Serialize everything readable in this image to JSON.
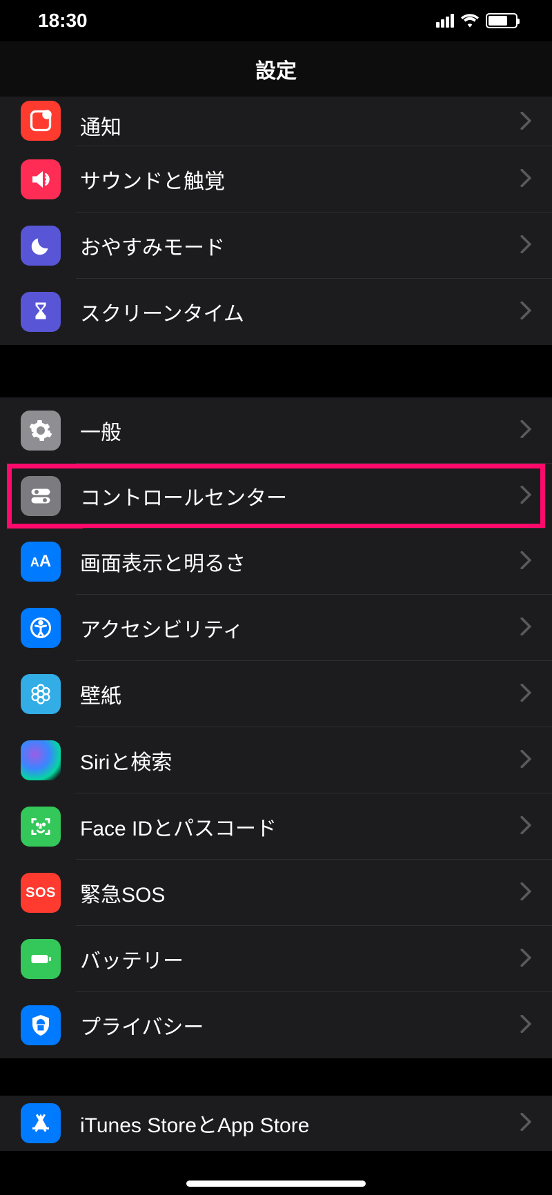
{
  "status": {
    "time": "18:30"
  },
  "nav": {
    "title": "設定"
  },
  "rows": {
    "notifications": "通知",
    "sounds": "サウンドと触覚",
    "dnd": "おやすみモード",
    "screentime": "スクリーンタイム",
    "general": "一般",
    "control_center": "コントロールセンター",
    "display": "画面表示と明るさ",
    "accessibility": "アクセシビリティ",
    "wallpaper": "壁紙",
    "siri": "Siriと検索",
    "faceid": "Face IDとパスコード",
    "sos": "緊急SOS",
    "battery": "バッテリー",
    "privacy": "プライバシー",
    "itunes": "iTunes StoreとApp Store"
  },
  "icon_text": {
    "sos": "SOS",
    "aa_small": "A",
    "aa_big": "A"
  }
}
